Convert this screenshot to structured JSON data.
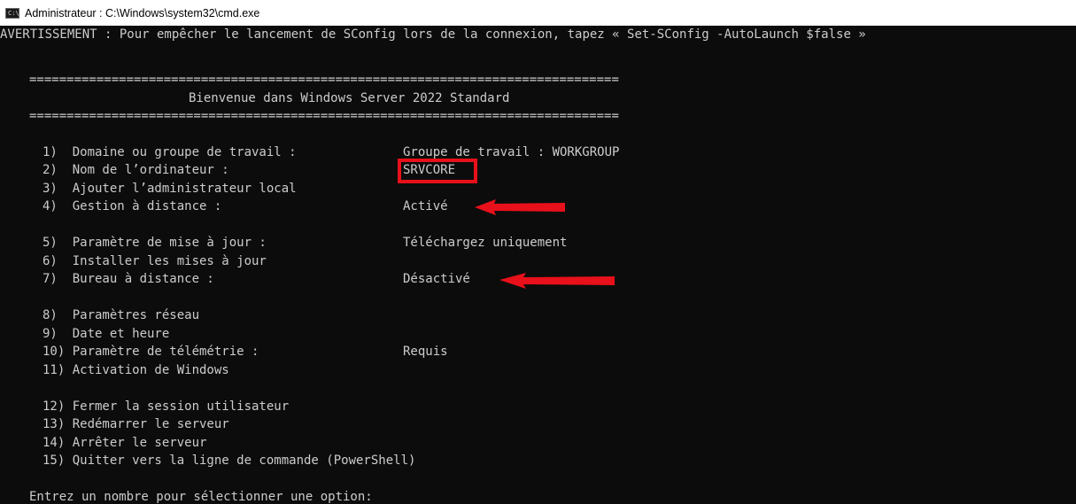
{
  "window": {
    "title": "Administrateur : C:\\Windows\\system32\\cmd.exe",
    "icon": "cmd-icon",
    "icon_glyph": "C:\\"
  },
  "console": {
    "warning": "AVERTISSEMENT : Pour empêcher le lancement de SConfig lors de la connexion, tapez « Set-SConfig -AutoLaunch $false »",
    "separator": "===============================================================================",
    "welcome": "Bienvenue dans Windows Server 2022 Standard",
    "menu": [
      {
        "label": "1)  Domaine ou groupe de travail :",
        "value": "Groupe de travail : WORKGROUP"
      },
      {
        "label": "2)  Nom de l’ordinateur :",
        "value": "SRVCORE"
      },
      {
        "label": "3)  Ajouter l’administrateur local",
        "value": ""
      },
      {
        "label": "4)  Gestion à distance :",
        "value": "Activé"
      },
      {
        "label": "5)  Paramètre de mise à jour :",
        "value": "Téléchargez uniquement"
      },
      {
        "label": "6)  Installer les mises à jour",
        "value": ""
      },
      {
        "label": "7)  Bureau à distance :",
        "value": "Désactivé"
      },
      {
        "label": "8)  Paramètres réseau",
        "value": ""
      },
      {
        "label": "9)  Date et heure",
        "value": ""
      },
      {
        "label": "10) Paramètre de télémétrie :",
        "value": "Requis"
      },
      {
        "label": "11) Activation de Windows",
        "value": ""
      },
      {
        "label": "12) Fermer la session utilisateur",
        "value": ""
      },
      {
        "label": "13) Redémarrer le serveur",
        "value": ""
      },
      {
        "label": "14) Arrêter le serveur",
        "value": ""
      },
      {
        "label": "15) Quitter vers la ligne de commande (PowerShell)",
        "value": ""
      }
    ],
    "prompt": "Entrez un nombre pour sélectionner une option:"
  },
  "colors": {
    "console_bg": "#0c0c0c",
    "console_text": "#cccccc",
    "annotation_red": "#e8101a",
    "titlebar_bg": "#ffffff"
  }
}
